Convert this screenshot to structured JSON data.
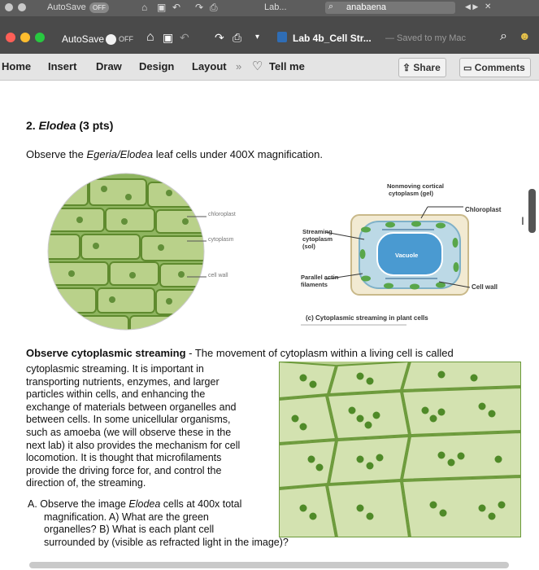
{
  "titlebar_back": {
    "autosave_label": "AutoSave",
    "toggle_state": "OFF",
    "doc_title": "Lab...",
    "search_value": "anabaena"
  },
  "titlebar": {
    "autosave_label": "AutoSave",
    "toggle_state": "OFF",
    "doc_title": "Lab 4b_Cell Str...",
    "saved_status": "— Saved to my Mac"
  },
  "ribbon": {
    "tabs": [
      "Home",
      "Insert",
      "Draw",
      "Design",
      "Layout"
    ],
    "overflow": "»",
    "tell_me": "Tell me",
    "share_label": "Share",
    "comments_label": "Comments"
  },
  "document": {
    "heading_num": "2.",
    "heading_name": "Elodea",
    "heading_pts": "(3 pts)",
    "observe_pre": "Observe the ",
    "observe_species": "Egeria/Elodea",
    "observe_post": " leaf cells under 400X magnification.",
    "micro_labels": {
      "chloroplast": "chloroplast",
      "cytoplasm": "cytoplasm",
      "cell_wall": "cell wall"
    },
    "diagram_labels": {
      "nonmoving": "Nonmoving cortical",
      "nonmoving2": "cytoplasm (gel)",
      "chloroplast": "Chloroplast",
      "streaming": "Streaming",
      "streaming2": "cytoplasm",
      "streaming3": "(sol)",
      "vacuole": "Vacuole",
      "parallel": "Parallel actin",
      "parallel2": "filaments",
      "cell_wall": "Cell wall",
      "caption": "(c) Cytoplasmic streaming in plant cells"
    },
    "streaming_title": "Observe cytoplasmic streaming",
    "streaming_intro": " - The movement of cytoplasm within a living cell is called",
    "paragraph_lines": [
      "cytoplasmic streaming. It is important in",
      "transporting nutrients, enzymes, and larger",
      "particles within cells, and enhancing the",
      "exchange of materials between organelles and",
      "between cells. In some unicellular organisms,",
      "such as amoeba (we will observe these in the",
      "next lab) it also provides the mechanism for cell",
      "locomotion. It is thought that microfilaments",
      "provide the driving force for, and control the",
      "direction of, the streaming."
    ],
    "question_letter": "A.",
    "question_pre": "Observe the image ",
    "question_species": "Elodea",
    "question_post": " cells at 400x total",
    "question_lines": [
      "magnification. A) What are the green",
      "organelles? B) What is each plant cell",
      "surrounded by (visible as refracted light in the image)?"
    ]
  },
  "colors": {
    "accent_green": "#3a8a2a",
    "close_red": "#ff5f57",
    "min_yellow": "#ffbd2e",
    "max_green": "#28c840"
  }
}
